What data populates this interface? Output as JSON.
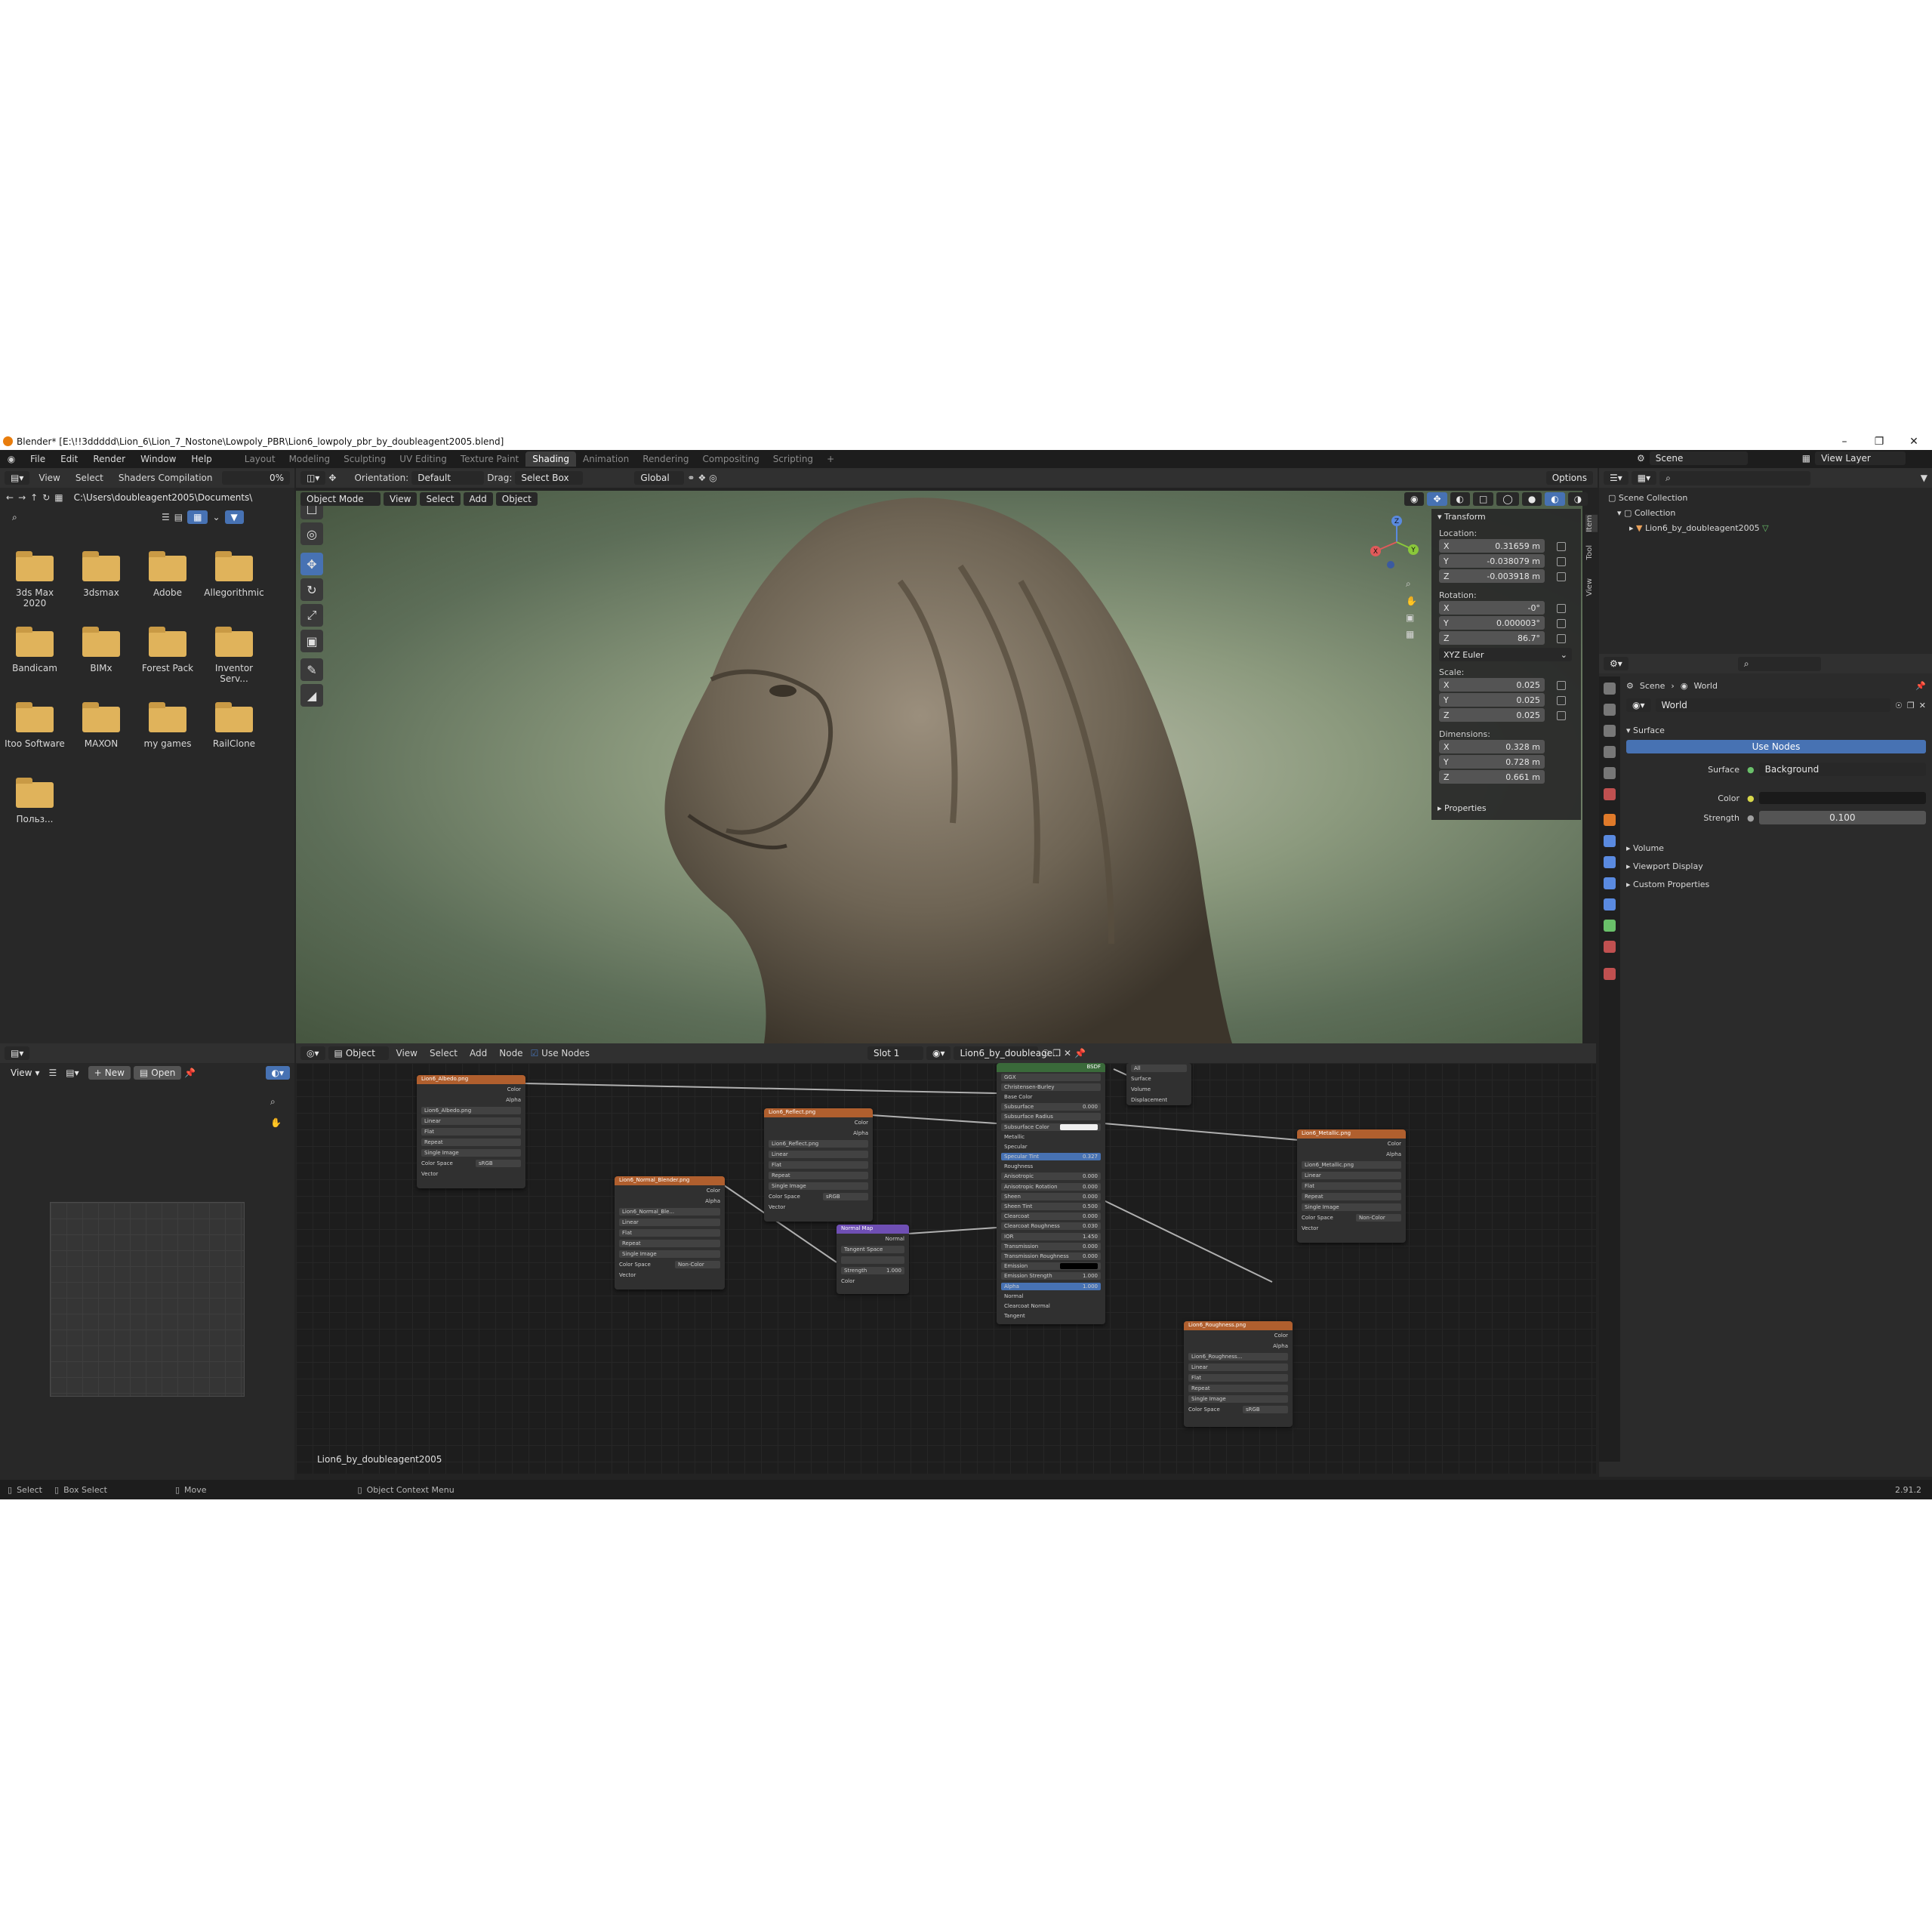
{
  "window": {
    "title": "Blender* [E:\\!!3ddddd\\Lion_6\\Lion_7_Nostone\\Lowpoly_PBR\\Lion6_lowpoly_pbr_by_doubleagent2005.blend]",
    "version": "2.91.2"
  },
  "menu": [
    "File",
    "Edit",
    "Render",
    "Window",
    "Help"
  ],
  "workspaces": [
    {
      "label": "Layout",
      "active": false
    },
    {
      "label": "Modeling",
      "active": false
    },
    {
      "label": "Sculpting",
      "active": false
    },
    {
      "label": "UV Editing",
      "active": false
    },
    {
      "label": "Texture Paint",
      "active": false
    },
    {
      "label": "Shading",
      "active": true
    },
    {
      "label": "Animation",
      "active": false
    },
    {
      "label": "Rendering",
      "active": false
    },
    {
      "label": "Compositing",
      "active": false
    },
    {
      "label": "Scripting",
      "active": false
    }
  ],
  "scene": {
    "name": "Scene",
    "view_layer": "View Layer"
  },
  "file_browser": {
    "header": {
      "view": "View",
      "select": "Select",
      "bookmark": "Shaders Compilation",
      "progress": "0%"
    },
    "path": "C:\\Users\\doubleagent2005\\Documents\\",
    "folders": [
      "3ds Max 2020",
      "3dsmax",
      "Adobe",
      "Allegorithmic",
      "Bandicam",
      "BIMx",
      "Forest Pack",
      "Inventor Serv...",
      "Itoo Software",
      "MAXON",
      "my games",
      "RailClone",
      "Польз..."
    ]
  },
  "viewport_header": {
    "orientation_label": "Orientation:",
    "orientation": "Default",
    "drag_label": "Drag:",
    "drag": "Select Box",
    "transform": "Global",
    "options": "Options",
    "mode": "Object Mode",
    "menus": [
      "View",
      "Select",
      "Add",
      "Object"
    ]
  },
  "npanel": {
    "title": "Transform",
    "location_label": "Location:",
    "location": {
      "x": "0.31659 m",
      "y": "-0.038079 m",
      "z": "-0.003918 m"
    },
    "rotation_label": "Rotation:",
    "rotation": {
      "x": "-0°",
      "y": "0.000003°",
      "z": "86.7°"
    },
    "rotation_mode": "XYZ Euler",
    "scale_label": "Scale:",
    "scale": {
      "x": "0.025",
      "y": "0.025",
      "z": "0.025"
    },
    "dimensions_label": "Dimensions:",
    "dimensions": {
      "x": "0.328 m",
      "y": "0.728 m",
      "z": "0.661 m"
    },
    "properties": "Properties",
    "tabs": [
      "Item",
      "Tool",
      "View"
    ]
  },
  "outliner": {
    "scene_collection": "Scene Collection",
    "collection": "Collection",
    "object": "Lion6_by_doubleagent2005"
  },
  "properties": {
    "breadcrumb_scene": "Scene",
    "breadcrumb_world": "World",
    "world_name": "World",
    "surface_section": "Surface",
    "use_nodes": "Use Nodes",
    "surface_label": "Surface",
    "surface_value": "Background",
    "color_label": "Color",
    "strength_label": "Strength",
    "strength_value": "0.100",
    "sections": [
      "Volume",
      "Viewport Display",
      "Custom Properties"
    ]
  },
  "image_editor": {
    "view": "View",
    "new": "New",
    "open": "Open"
  },
  "node_editor": {
    "type": "Object",
    "menus": [
      "View",
      "Select",
      "Add",
      "Node"
    ],
    "use_nodes": "Use Nodes",
    "slot": "Slot 1",
    "material": "Lion6_by_doubleage...",
    "footer_label": "Lion6_by_doubleagent2005",
    "nodes": {
      "albedo": "Lion6_Albedo.png",
      "albedo_file": "Lion6_Albedo.png",
      "reflect": "Lion6_Reflect.png",
      "reflect_file": "Lion6_Reflect.png",
      "normal": "Lion6_Normal_Blender.png",
      "normal_file": "Lion6_Normal_Ble...",
      "normalmap": "Normal Map",
      "metallic": "Lion6_Metallic.png",
      "metallic_file": "Lion6_Metallic.png",
      "roughness": "Lion6_Roughness.png",
      "roughness_file": "Lion6_Roughness...",
      "bsdf": "BSDF",
      "output": "All",
      "color": "Color",
      "alpha": "Alpha",
      "linear": "Linear",
      "flat": "Flat",
      "repeat": "Repeat",
      "single_image": "Single Image",
      "color_space": "Color Space",
      "srgb": "sRGB",
      "noncolor": "Non-Color",
      "vector": "Vector",
      "normal_label": "Normal",
      "tangent_space": "Tangent Space",
      "strength": "Strength",
      "strength_val": "1.000",
      "surface": "Surface",
      "volume": "Volume",
      "displacement": "Displacement",
      "bsdf_rows": [
        {
          "label": "GGX",
          "value": ""
        },
        {
          "label": "Christensen-Burley",
          "value": ""
        },
        {
          "label": "Base Color",
          "value": ""
        },
        {
          "label": "Subsurface",
          "value": "0.000"
        },
        {
          "label": "Subsurface Radius",
          "value": ""
        },
        {
          "label": "Subsurface Color",
          "value": ""
        },
        {
          "label": "Metallic",
          "value": ""
        },
        {
          "label": "Specular",
          "value": ""
        },
        {
          "label": "Specular Tint",
          "value": "0.327"
        },
        {
          "label": "Roughness",
          "value": ""
        },
        {
          "label": "Anisotropic",
          "value": "0.000"
        },
        {
          "label": "Anisotropic Rotation",
          "value": "0.000"
        },
        {
          "label": "Sheen",
          "value": "0.000"
        },
        {
          "label": "Sheen Tint",
          "value": "0.500"
        },
        {
          "label": "Clearcoat",
          "value": "0.000"
        },
        {
          "label": "Clearcoat Roughness",
          "value": "0.030"
        },
        {
          "label": "IOR",
          "value": "1.450"
        },
        {
          "label": "Transmission",
          "value": "0.000"
        },
        {
          "label": "Transmission Roughness",
          "value": "0.000"
        },
        {
          "label": "Emission",
          "value": ""
        },
        {
          "label": "Emission Strength",
          "value": "1.000"
        },
        {
          "label": "Alpha",
          "value": "1.000"
        },
        {
          "label": "Normal",
          "value": ""
        },
        {
          "label": "Clearcoat Normal",
          "value": ""
        },
        {
          "label": "Tangent",
          "value": ""
        }
      ]
    }
  },
  "statusbar": {
    "select": "Select",
    "box_select": "Box Select",
    "move": "Move",
    "context": "Object Context Menu"
  }
}
